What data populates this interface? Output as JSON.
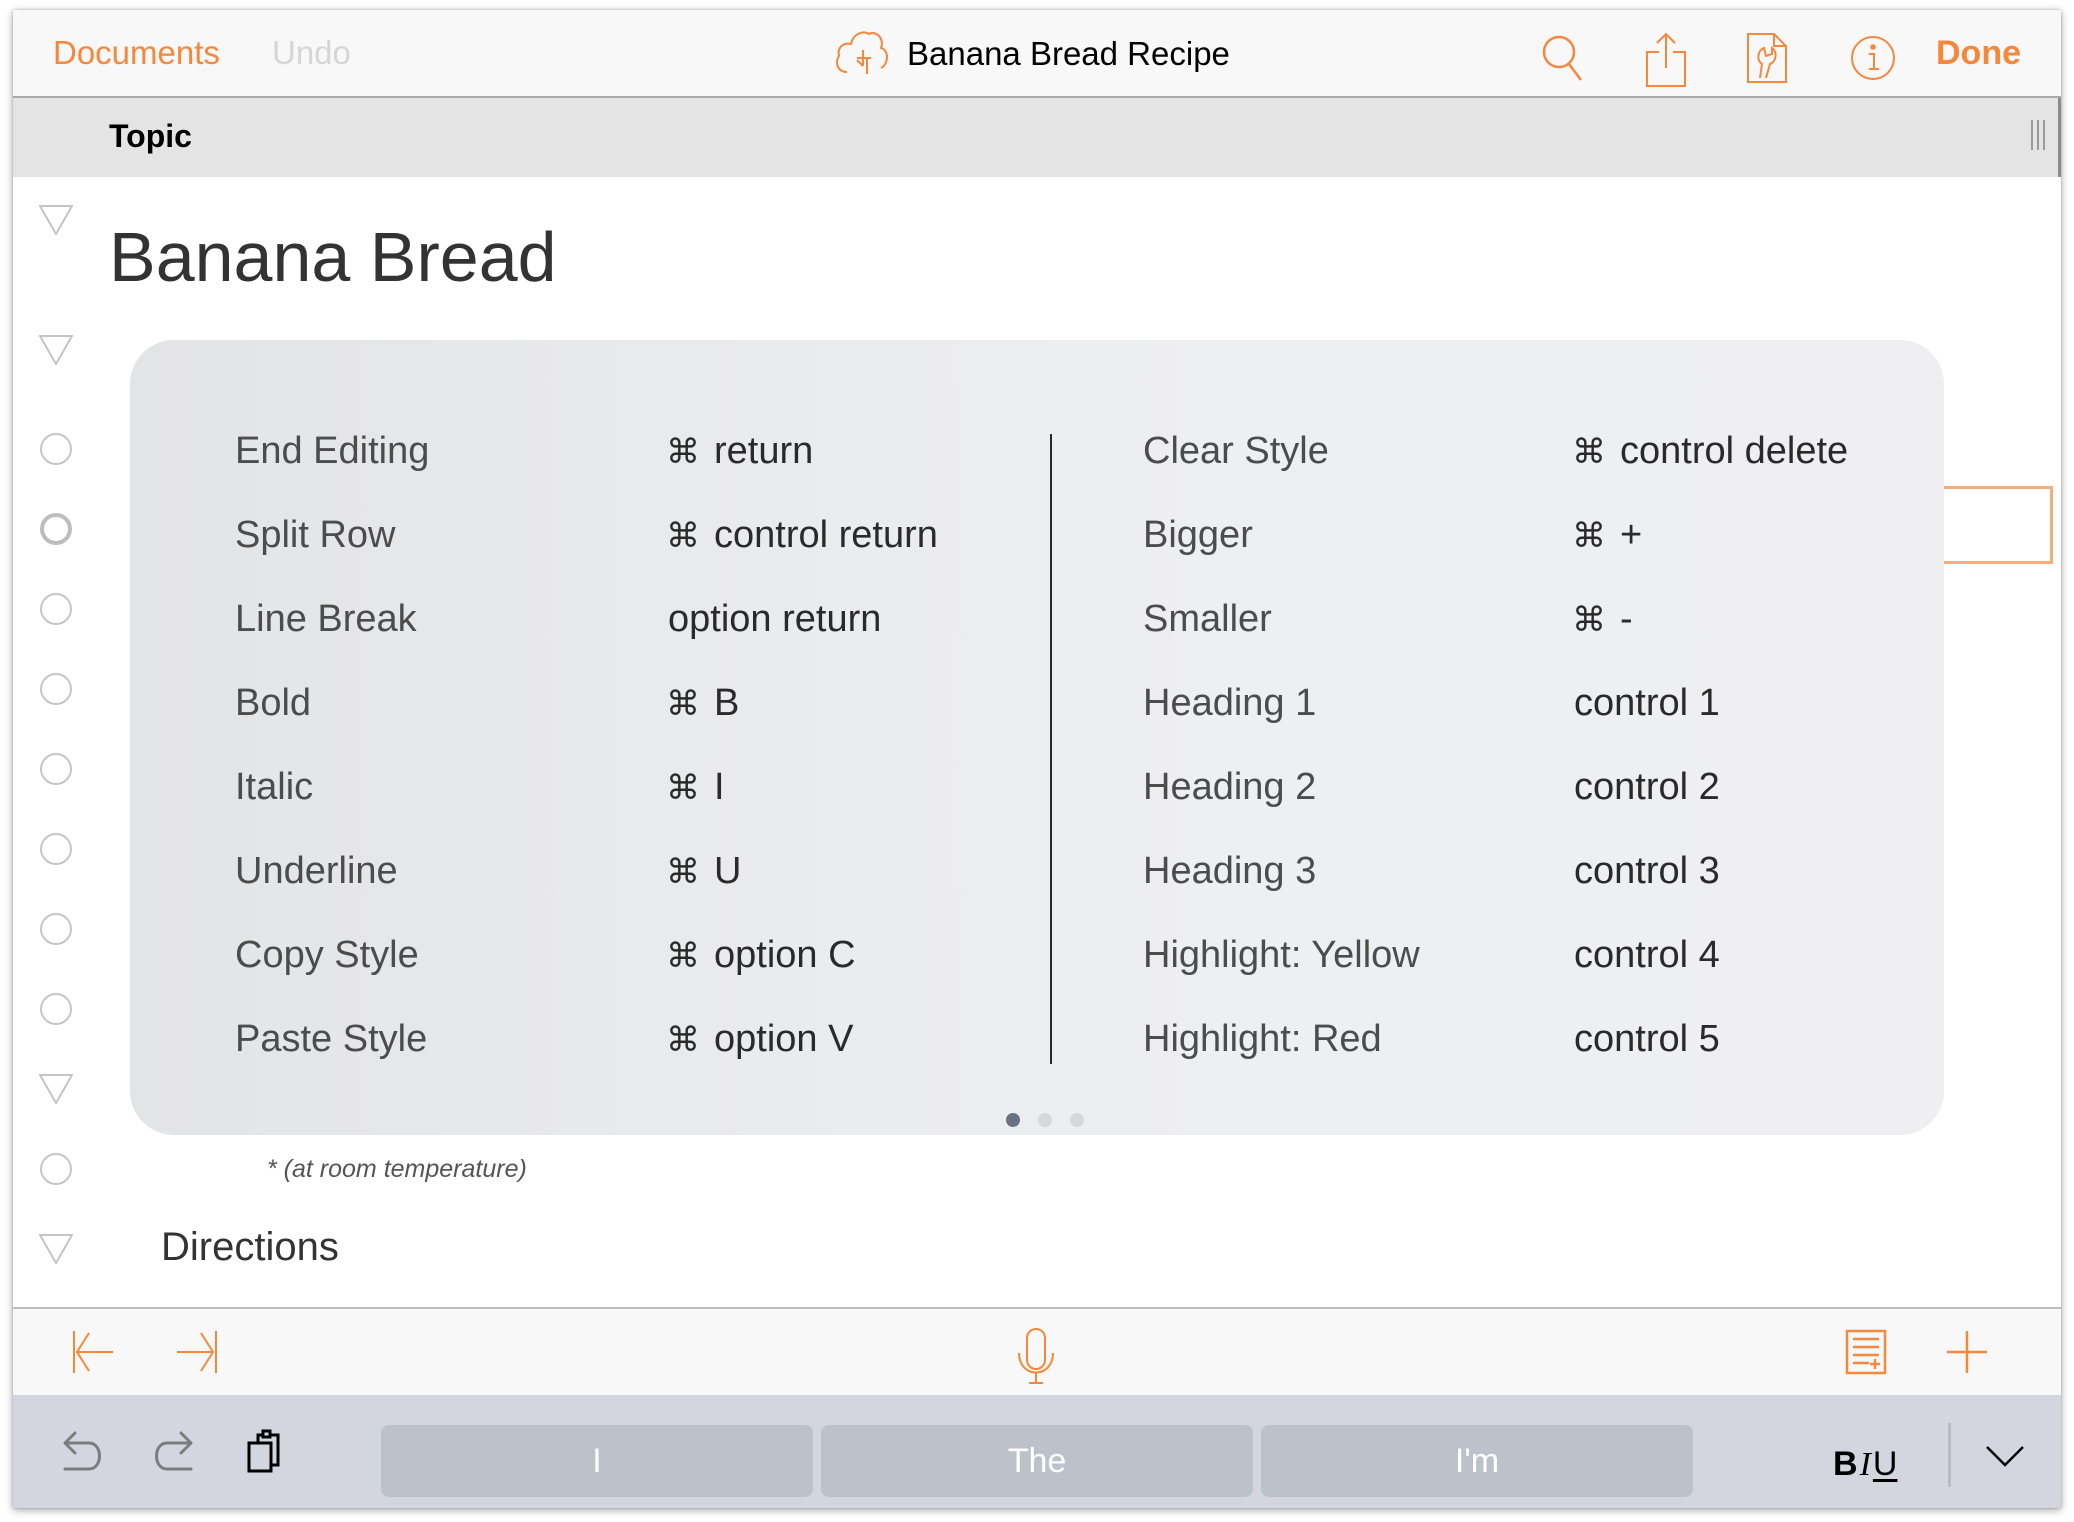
{
  "toolbar": {
    "documents_label": "Documents",
    "undo_label": "Undo",
    "title": "Banana Bread Recipe",
    "done_label": "Done",
    "icons": [
      "cloud-sync-icon",
      "search-icon",
      "share-icon",
      "document-tools-icon",
      "info-icon"
    ]
  },
  "column_header": {
    "topic_label": "Topic"
  },
  "outline": {
    "title": "Banana Bread",
    "note": "* (at room temperature)",
    "directions_label": "Directions"
  },
  "shortcuts": {
    "left": [
      {
        "action": "End Editing",
        "cmd": true,
        "key": "return"
      },
      {
        "action": "Split Row",
        "cmd": true,
        "key": "control return"
      },
      {
        "action": "Line Break",
        "cmd": false,
        "key": "option return"
      },
      {
        "action": "Bold",
        "cmd": true,
        "key": "B"
      },
      {
        "action": "Italic",
        "cmd": true,
        "key": "I"
      },
      {
        "action": "Underline",
        "cmd": true,
        "key": "U"
      },
      {
        "action": "Copy Style",
        "cmd": true,
        "key": "option C"
      },
      {
        "action": "Paste Style",
        "cmd": true,
        "key": "option V"
      }
    ],
    "right": [
      {
        "action": "Clear Style",
        "cmd": true,
        "key": "control delete"
      },
      {
        "action": "Bigger",
        "cmd": true,
        "key": "+"
      },
      {
        "action": "Smaller",
        "cmd": true,
        "key": "-"
      },
      {
        "action": "Heading 1",
        "cmd": false,
        "key": "control 1"
      },
      {
        "action": "Heading 2",
        "cmd": false,
        "key": "control 2"
      },
      {
        "action": "Heading 3",
        "cmd": false,
        "key": "control 3"
      },
      {
        "action": "Highlight: Yellow",
        "cmd": false,
        "key": "control 4"
      },
      {
        "action": "Highlight: Red",
        "cmd": false,
        "key": "control 5"
      }
    ],
    "cmd_symbol": "⌘",
    "pages": 3,
    "current_page": 1
  },
  "keyboard_bar": {
    "suggestions": [
      "I",
      "The",
      "I'm"
    ],
    "bold": "B",
    "italic": "I",
    "underline": "U"
  },
  "colors": {
    "accent": "#f5883b",
    "toolbar_bg": "#f8f8f8",
    "header_bg": "#e4e4e4",
    "keyboard_bg": "#d3d6de",
    "suggestion_bg": "#bcc2ca"
  }
}
